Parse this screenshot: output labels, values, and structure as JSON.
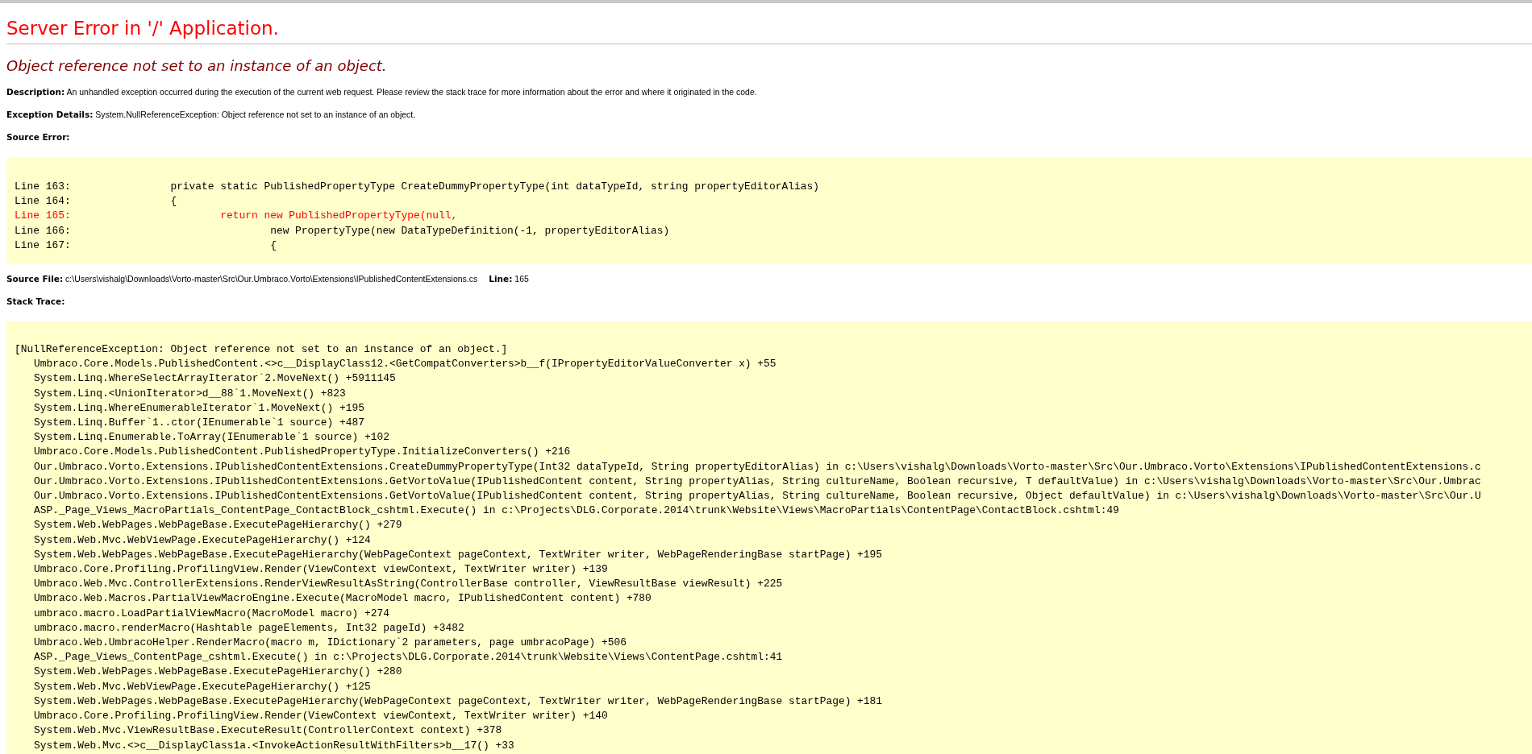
{
  "title": "Server Error in '/' Application.",
  "message": "Object reference not set to an instance of an object.",
  "description": {
    "label": "Description:",
    "text": "An unhandled exception occurred during the execution of the current web request. Please review the stack trace for more information about the error and where it originated in the code."
  },
  "exception_details": {
    "label": "Exception Details:",
    "text": "System.NullReferenceException: Object reference not set to an instance of an object."
  },
  "source_error": {
    "label": "Source Error:",
    "lines": [
      {
        "text": "Line 163:                private static PublishedPropertyType CreateDummyPropertyType(int dataTypeId, string propertyEditorAlias)",
        "highlighted": false
      },
      {
        "text": "Line 164:                {",
        "highlighted": false
      },
      {
        "text": "Line 165:                        return new PublishedPropertyType(null,",
        "highlighted": true
      },
      {
        "text": "Line 166:                                new PropertyType(new DataTypeDefinition(-1, propertyEditorAlias)",
        "highlighted": false
      },
      {
        "text": "Line 167:                                {",
        "highlighted": false
      }
    ]
  },
  "source_file": {
    "label": "Source File:",
    "path": "c:\\Users\\vishalg\\Downloads\\Vorto-master\\Src\\Our.Umbraco.Vorto\\Extensions\\IPublishedContentExtensions.cs",
    "line_label": "Line:",
    "line": "165"
  },
  "stack_trace": {
    "label": "Stack Trace:",
    "lines": [
      {
        "kind": "exception",
        "text": "[NullReferenceException: Object reference not set to an instance of an object.]"
      },
      {
        "kind": "frame",
        "text": "Umbraco.Core.Models.PublishedContent.<>c__DisplayClass12.<GetCompatConverters>b__f(IPropertyEditorValueConverter x) +55"
      },
      {
        "kind": "frame",
        "text": "System.Linq.WhereSelectArrayIterator`2.MoveNext() +5911145"
      },
      {
        "kind": "frame",
        "text": "System.Linq.<UnionIterator>d__88`1.MoveNext() +823"
      },
      {
        "kind": "frame",
        "text": "System.Linq.WhereEnumerableIterator`1.MoveNext() +195"
      },
      {
        "kind": "frame",
        "text": "System.Linq.Buffer`1..ctor(IEnumerable`1 source) +487"
      },
      {
        "kind": "frame",
        "text": "System.Linq.Enumerable.ToArray(IEnumerable`1 source) +102"
      },
      {
        "kind": "frame",
        "text": "Umbraco.Core.Models.PublishedContent.PublishedPropertyType.InitializeConverters() +216"
      },
      {
        "kind": "frame",
        "text": "Our.Umbraco.Vorto.Extensions.IPublishedContentExtensions.CreateDummyPropertyType(Int32 dataTypeId, String propertyEditorAlias) in c:\\Users\\vishalg\\Downloads\\Vorto-master\\Src\\Our.Umbraco.Vorto\\Extensions\\IPublishedContentExtensions.c"
      },
      {
        "kind": "frame",
        "text": "Our.Umbraco.Vorto.Extensions.IPublishedContentExtensions.GetVortoValue(IPublishedContent content, String propertyAlias, String cultureName, Boolean recursive, T defaultValue) in c:\\Users\\vishalg\\Downloads\\Vorto-master\\Src\\Our.Umbrac"
      },
      {
        "kind": "frame",
        "text": "Our.Umbraco.Vorto.Extensions.IPublishedContentExtensions.GetVortoValue(IPublishedContent content, String propertyAlias, String cultureName, Boolean recursive, Object defaultValue) in c:\\Users\\vishalg\\Downloads\\Vorto-master\\Src\\Our.U"
      },
      {
        "kind": "frame",
        "text": "ASP._Page_Views_MacroPartials_ContentPage_ContactBlock_cshtml.Execute() in c:\\Projects\\DLG.Corporate.2014\\trunk\\Website\\Views\\MacroPartials\\ContentPage\\ContactBlock.cshtml:49"
      },
      {
        "kind": "frame",
        "text": "System.Web.WebPages.WebPageBase.ExecutePageHierarchy() +279"
      },
      {
        "kind": "frame",
        "text": "System.Web.Mvc.WebViewPage.ExecutePageHierarchy() +124"
      },
      {
        "kind": "frame",
        "text": "System.Web.WebPages.WebPageBase.ExecutePageHierarchy(WebPageContext pageContext, TextWriter writer, WebPageRenderingBase startPage) +195"
      },
      {
        "kind": "frame",
        "text": "Umbraco.Core.Profiling.ProfilingView.Render(ViewContext viewContext, TextWriter writer) +139"
      },
      {
        "kind": "frame",
        "text": "Umbraco.Web.Mvc.ControllerExtensions.RenderViewResultAsString(ControllerBase controller, ViewResultBase viewResult) +225"
      },
      {
        "kind": "frame",
        "text": "Umbraco.Web.Macros.PartialViewMacroEngine.Execute(MacroModel macro, IPublishedContent content) +780"
      },
      {
        "kind": "frame",
        "text": "umbraco.macro.LoadPartialViewMacro(MacroModel macro) +274"
      },
      {
        "kind": "frame",
        "text": "umbraco.macro.renderMacro(Hashtable pageElements, Int32 pageId) +3482"
      },
      {
        "kind": "frame",
        "text": "Umbraco.Web.UmbracoHelper.RenderMacro(macro m, IDictionary`2 parameters, page umbracoPage) +506"
      },
      {
        "kind": "frame",
        "text": "ASP._Page_Views_ContentPage_cshtml.Execute() in c:\\Projects\\DLG.Corporate.2014\\trunk\\Website\\Views\\ContentPage.cshtml:41"
      },
      {
        "kind": "frame",
        "text": "System.Web.WebPages.WebPageBase.ExecutePageHierarchy() +280"
      },
      {
        "kind": "frame",
        "text": "System.Web.Mvc.WebViewPage.ExecutePageHierarchy() +125"
      },
      {
        "kind": "frame",
        "text": "System.Web.WebPages.WebPageBase.ExecutePageHierarchy(WebPageContext pageContext, TextWriter writer, WebPageRenderingBase startPage) +181"
      },
      {
        "kind": "frame",
        "text": "Umbraco.Core.Profiling.ProfilingView.Render(ViewContext viewContext, TextWriter writer) +140"
      },
      {
        "kind": "frame",
        "text": "System.Web.Mvc.ViewResultBase.ExecuteResult(ControllerContext context) +378"
      },
      {
        "kind": "frame",
        "text": "System.Web.Mvc.<>c__DisplayClass1a.<InvokeActionResultWithFilters>b__17() +33"
      }
    ]
  }
}
